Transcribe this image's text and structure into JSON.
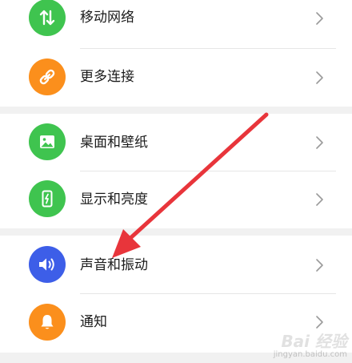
{
  "settings": {
    "items": [
      {
        "label": "移动网络",
        "icon": "mobile-network-icon",
        "color": "#3fc44f"
      },
      {
        "label": "更多连接",
        "icon": "link-icon",
        "color": "#fb8f1c"
      },
      {
        "label": "桌面和壁纸",
        "icon": "wallpaper-icon",
        "color": "#3fc44f"
      },
      {
        "label": "显示和亮度",
        "icon": "display-brightness-icon",
        "color": "#3fc44f"
      },
      {
        "label": "声音和振动",
        "icon": "sound-icon",
        "color": "#3d5ee8"
      },
      {
        "label": "通知",
        "icon": "bell-icon",
        "color": "#fb8f1c"
      }
    ]
  },
  "annotation": {
    "arrow_color": "#e8353b"
  },
  "watermark": {
    "brand": "Bai 经验",
    "url": "jingyan.baidu.com"
  }
}
